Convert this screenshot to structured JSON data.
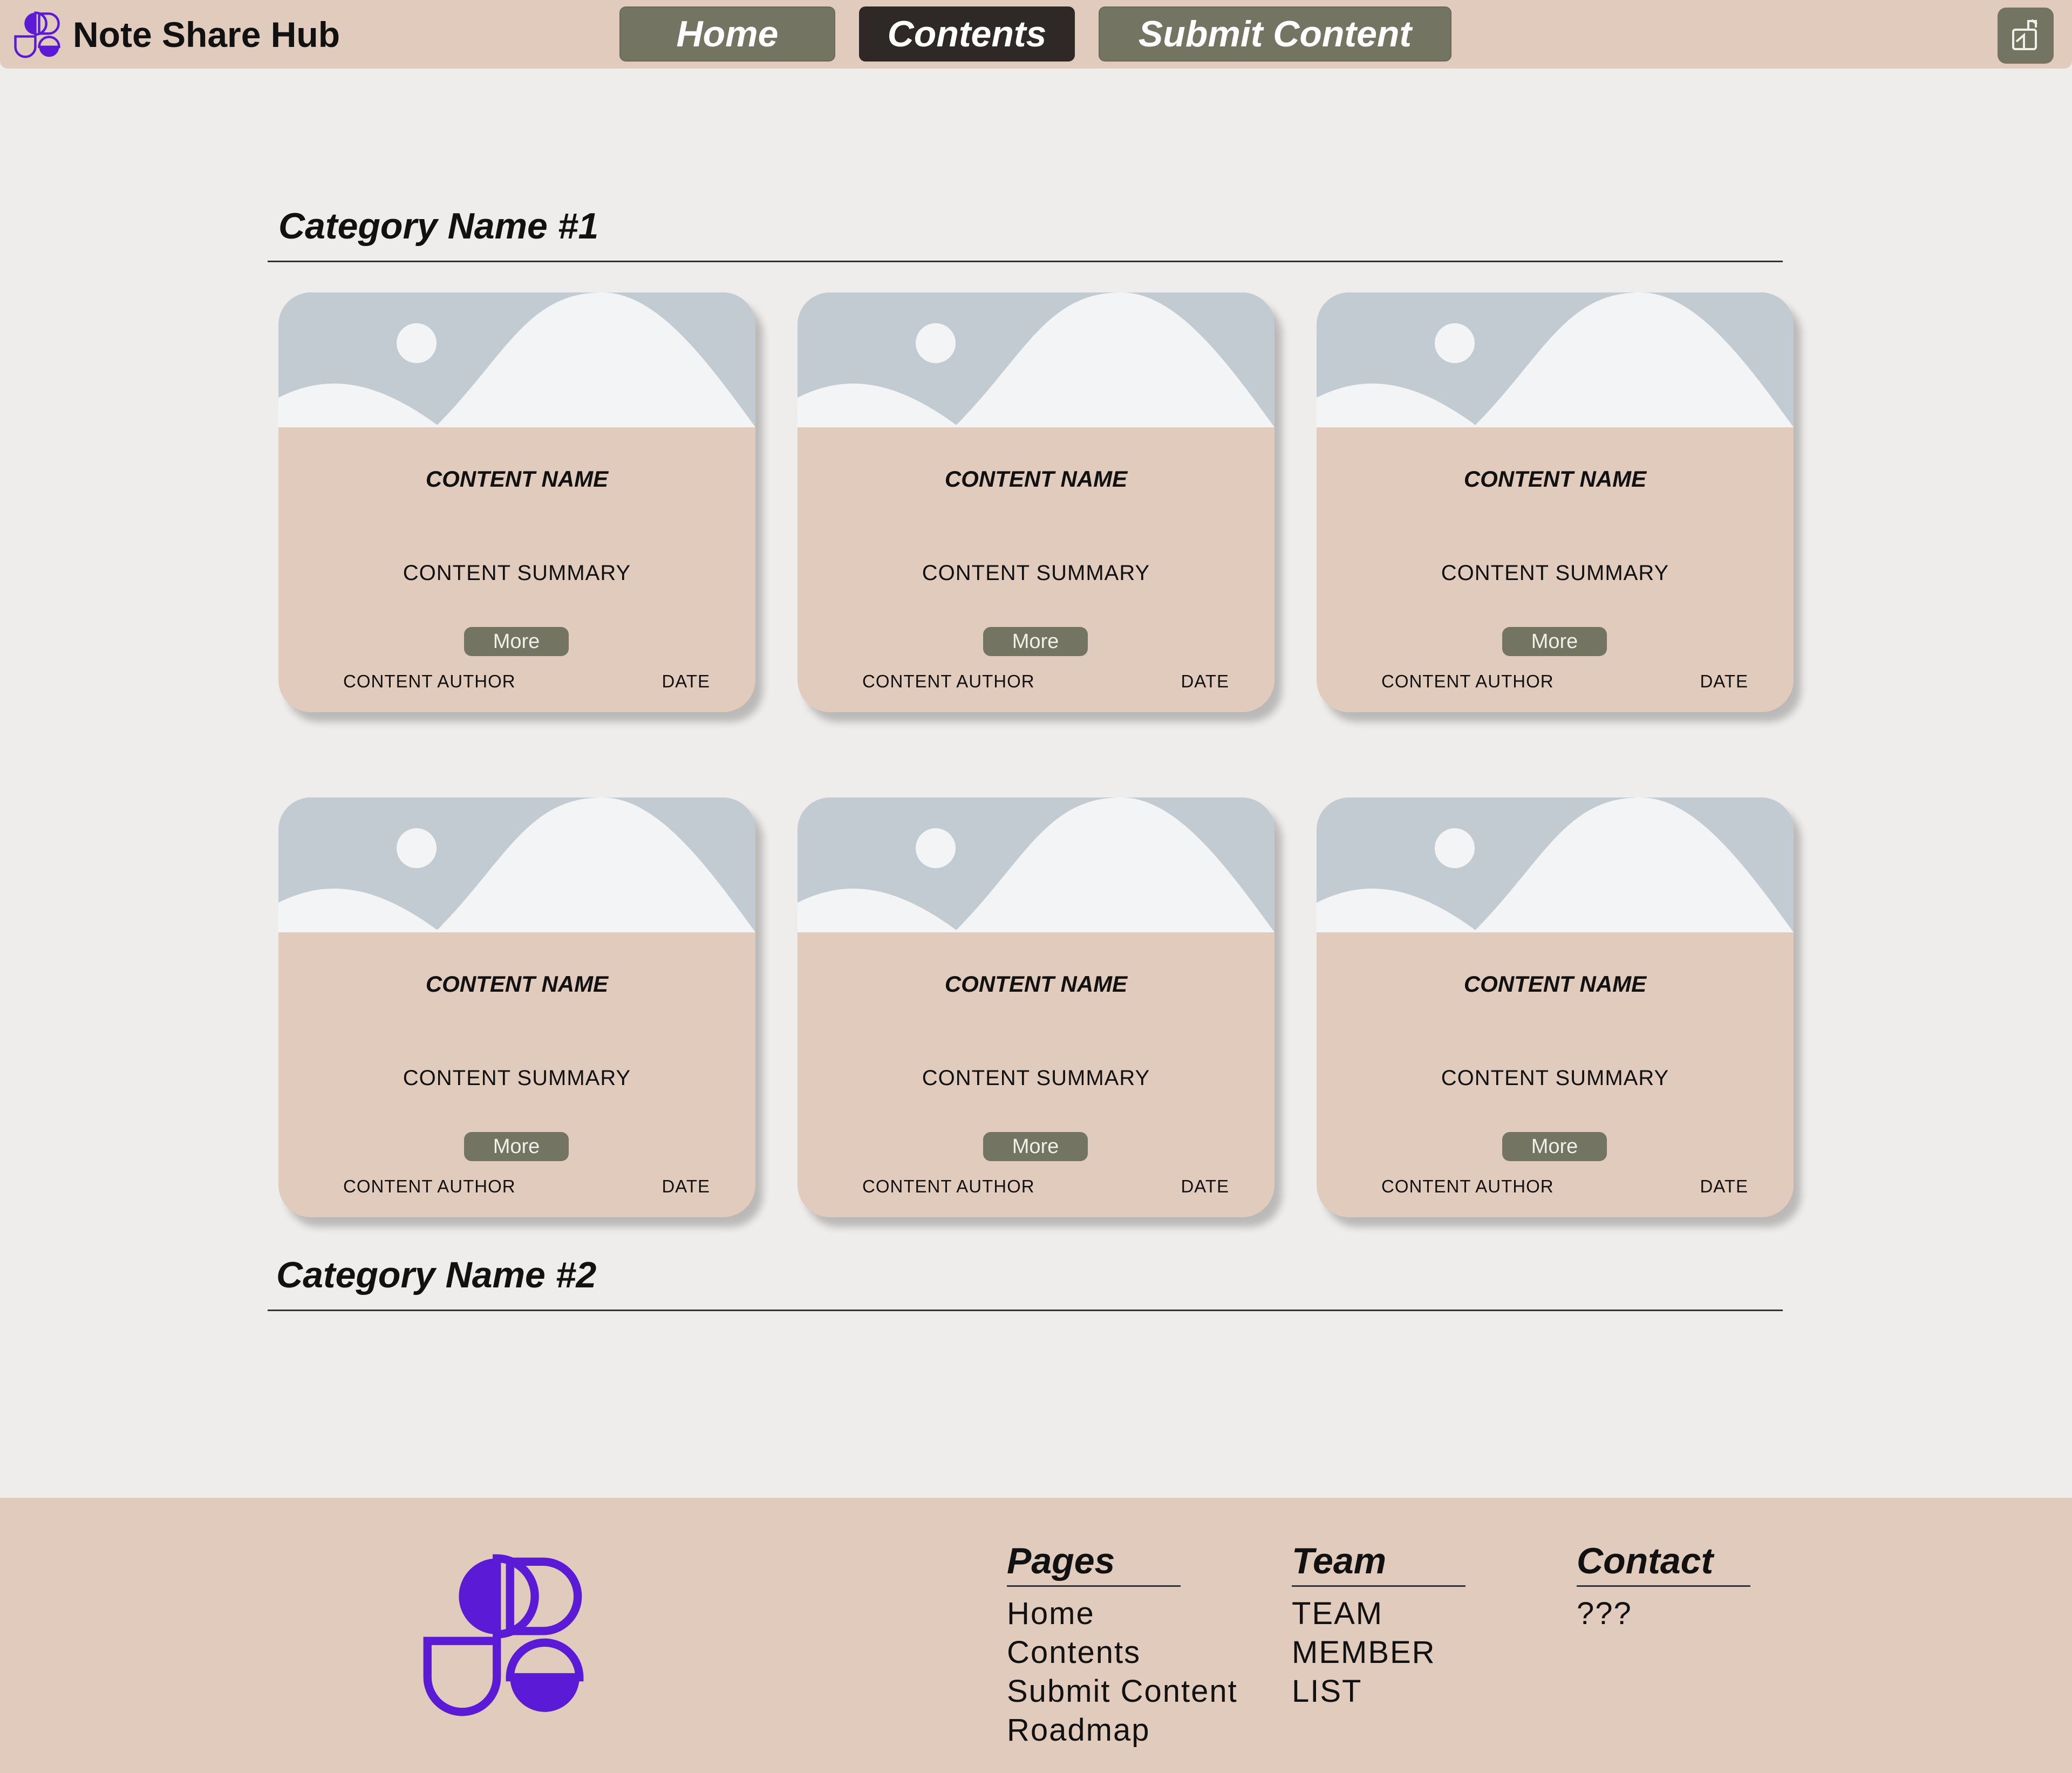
{
  "header": {
    "brand_name": "Note Share Hub",
    "nav": {
      "home": "Home",
      "contents": "Contents",
      "submit": "Submit Content"
    },
    "export_icon": "export-icon"
  },
  "colors": {
    "header_bg": "#e0cbbd",
    "page_bg": "#efedeb",
    "button_bg": "#737462",
    "active_button_bg": "#2e2826",
    "brand_purple": "#5a1ad6",
    "thumb_bg": "#c3cbd2",
    "thumb_fg": "#f3f4f5"
  },
  "categories": [
    {
      "name": "Category Name #1",
      "cards": [
        {
          "name": "CONTENT NAME",
          "summary": "CONTENT SUMMARY",
          "more": "More",
          "author": "CONTENT AUTHOR",
          "date": "DATE"
        },
        {
          "name": "CONTENT NAME",
          "summary": "CONTENT SUMMARY",
          "more": "More",
          "author": "CONTENT AUTHOR",
          "date": "DATE"
        },
        {
          "name": "CONTENT NAME",
          "summary": "CONTENT SUMMARY",
          "more": "More",
          "author": "CONTENT AUTHOR",
          "date": "DATE"
        },
        {
          "name": "CONTENT NAME",
          "summary": "CONTENT SUMMARY",
          "more": "More",
          "author": "CONTENT AUTHOR",
          "date": "DATE"
        },
        {
          "name": "CONTENT NAME",
          "summary": "CONTENT SUMMARY",
          "more": "More",
          "author": "CONTENT AUTHOR",
          "date": "DATE"
        },
        {
          "name": "CONTENT NAME",
          "summary": "CONTENT SUMMARY",
          "more": "More",
          "author": "CONTENT AUTHOR",
          "date": "DATE"
        }
      ]
    },
    {
      "name": "Category Name #2",
      "cards": []
    }
  ],
  "footer": {
    "pages": {
      "title": "Pages",
      "links": [
        "Home",
        "Contents",
        "Submit Content",
        "Roadmap"
      ]
    },
    "team": {
      "title": "Team",
      "links": [
        "TEAM",
        "MEMBER",
        "LIST"
      ]
    },
    "contact": {
      "title": "Contact",
      "links": [
        "???"
      ]
    }
  }
}
